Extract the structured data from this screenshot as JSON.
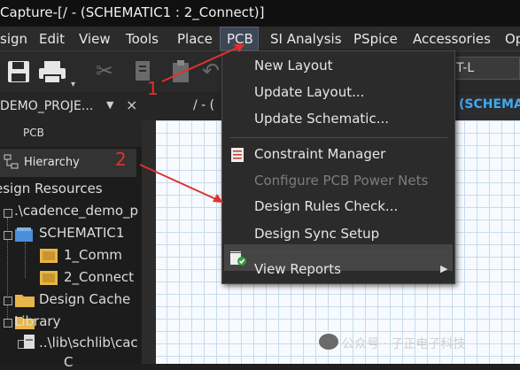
{
  "window": {
    "title": "Capture-[/ - (SCHEMATIC1 : 2_Connect)]"
  },
  "menubar": {
    "items": [
      "sign",
      "Edit",
      "View",
      "Tools",
      "Place",
      "PCB",
      "SI Analysis",
      "PSpice",
      "Accessories",
      "Op"
    ],
    "active": "PCB"
  },
  "toolbar": {
    "icons": [
      "save-icon",
      "print-icon",
      "cut-icon",
      "copy-icon",
      "paste-icon",
      "undo-icon"
    ],
    "select_value": "T-L"
  },
  "tabs": {
    "project": "DEMO_PROJE...",
    "document": "/ - (",
    "active": "(SCHEMA"
  },
  "panel": {
    "header": "PCB",
    "hierarchy_tab": "Hierarchy",
    "tree": [
      "esign Resources",
      ".\\cadence_demo_p",
      "SCHEMATIC1",
      "1_Comm",
      "2_Connect",
      "Design Cache",
      "Library",
      "..\\lib\\schlib\\cac",
      "C"
    ]
  },
  "pcb_menu": {
    "items": [
      {
        "label": "New Layout",
        "enabled": true
      },
      {
        "label": "Update Layout...",
        "enabled": true
      },
      {
        "label": "Update Schematic...",
        "enabled": true
      },
      {
        "label": "Constraint Manager",
        "enabled": true
      },
      {
        "label": "Configure PCB Power Nets",
        "enabled": false
      },
      {
        "label": "Design Rules Check...",
        "enabled": true,
        "highlighted": true
      },
      {
        "label": "Design Sync Setup",
        "enabled": true
      },
      {
        "label": "View Reports",
        "enabled": true,
        "submenu": true
      }
    ],
    "submenu_arrow": "▶"
  },
  "annotations": {
    "step1": "1",
    "step2": "2"
  },
  "watermark": {
    "text": "公众号 · 子正电子科技"
  },
  "colors": {
    "annotation_red": "#e03030",
    "active_tab_blue": "#3fa9f5",
    "folder_yellow": "#e8b54a",
    "check_green": "#2e9e40"
  }
}
